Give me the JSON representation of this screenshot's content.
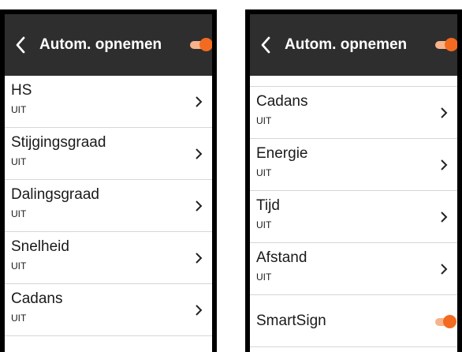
{
  "left": {
    "header": {
      "title": "Autom. opnemen"
    },
    "items": [
      {
        "label": "HS",
        "value": "UIT"
      },
      {
        "label": "Stijgingsgraad",
        "value": "UIT"
      },
      {
        "label": "Dalingsgraad",
        "value": "UIT"
      },
      {
        "label": "Snelheid",
        "value": "UIT"
      },
      {
        "label": "Cadans",
        "value": "UIT"
      }
    ]
  },
  "right": {
    "header": {
      "title": "Autom. opnemen"
    },
    "items": [
      {
        "label": "Cadans",
        "value": "UIT"
      },
      {
        "label": "Energie",
        "value": "UIT"
      },
      {
        "label": "Tijd",
        "value": "UIT"
      },
      {
        "label": "Afstand",
        "value": "UIT"
      }
    ],
    "smartsign": {
      "label": "SmartSign",
      "enabled": true
    }
  },
  "colors": {
    "accent": "#f26b21",
    "header_bg": "#2e2e2e"
  }
}
